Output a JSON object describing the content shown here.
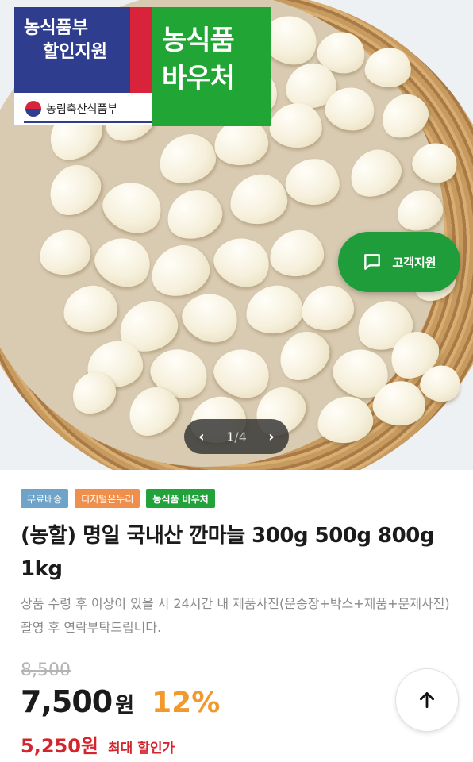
{
  "hero": {
    "badge_blue_line1": "농식품부",
    "badge_blue_line2": "할인지원",
    "badge_green_line1": "농식품",
    "badge_green_line2": "바우처",
    "ministry": "농림축산식품부"
  },
  "support_button": {
    "label": "고객지원",
    "icon": "chat-bubble-icon"
  },
  "pager": {
    "current": "1",
    "separator": "/",
    "total": "4"
  },
  "tags": [
    "무료배송",
    "디지털온누리",
    "농식품 바우처"
  ],
  "product": {
    "title": "(농할) 명일 국내산 깐마늘 300g 500g 800g 1kg",
    "description": "상품 수령 후 이상이 있을 시 24시간 내 제품사진(운송장+박스+제품+문제사진)촬영 후 연락부탁드립니다."
  },
  "price": {
    "original": "8,500",
    "sale": "7,500",
    "currency": "원",
    "discount": "12%",
    "max_discount_price": "5,250원",
    "max_discount_label": "최대 할인가"
  },
  "colors": {
    "support_green": "#1f9d3a",
    "discount_orange": "#f19a2b",
    "max_red": "#d4252d",
    "voucher_green": "#21a534",
    "ministry_blue": "#2f3d8f"
  }
}
